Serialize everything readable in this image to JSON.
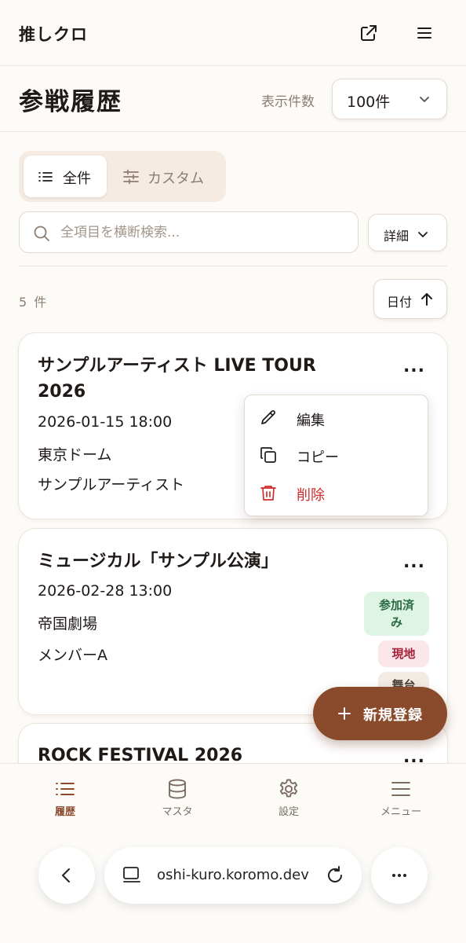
{
  "header": {
    "app_title": "推しクロ",
    "external_link_icon": "external-link-icon",
    "menu_icon": "hamburger-icon"
  },
  "page": {
    "title": "参戦履歴",
    "count_label": "表示件数",
    "count_value": "100件"
  },
  "tabs": [
    {
      "label": "全件",
      "icon": "list-icon",
      "active": true
    },
    {
      "label": "カスタム",
      "icon": "sliders-icon",
      "active": false
    }
  ],
  "search": {
    "placeholder": "全項目を横断検索...",
    "value": "",
    "detail_label": "詳細"
  },
  "results": {
    "count_text": "5 件",
    "sort_label": "日付",
    "sort_direction": "asc"
  },
  "cards": [
    {
      "title_line1": "サンプルアーティスト LIVE TOUR",
      "title_line2": "2026",
      "datetime": "2026-01-15 18:00",
      "venue": "東京ドーム",
      "artist": "サンプルアーティスト",
      "more": "..."
    },
    {
      "title_line1": "ミュージカル「サンプル公演」",
      "datetime": "2026-02-28 13:00",
      "venue": "帝国劇場",
      "artist": "メンバーA",
      "more": "...",
      "badges": [
        {
          "line1": "参加済",
          "line2": "み",
          "style": "green"
        },
        {
          "label": "現地",
          "style": "red"
        },
        {
          "label": "舞台",
          "style": "gray"
        }
      ]
    },
    {
      "title_line1": "ROCK FESTIVAL 2026",
      "more": "..."
    }
  ],
  "context_menu": [
    {
      "label": "編集",
      "icon": "pencil-icon",
      "danger": false
    },
    {
      "label": "コピー",
      "icon": "copy-icon",
      "danger": false
    },
    {
      "label": "削除",
      "icon": "trash-icon",
      "danger": true
    }
  ],
  "fab": {
    "label": "新規登録",
    "icon": "plus-icon"
  },
  "bottom_nav": [
    {
      "label": "履歴",
      "icon": "list-icon",
      "active": true
    },
    {
      "label": "マスタ",
      "icon": "database-icon",
      "active": false
    },
    {
      "label": "設定",
      "icon": "gear-icon",
      "active": false
    },
    {
      "label": "メニュー",
      "icon": "hamburger-icon",
      "active": false
    }
  ],
  "browser": {
    "url": "oshi-kuro.koromo.dev"
  },
  "colors": {
    "accent": "#8a4a2c",
    "background": "#fdfbf8",
    "danger": "#d02b2b",
    "muted_text": "#8b7d72"
  }
}
